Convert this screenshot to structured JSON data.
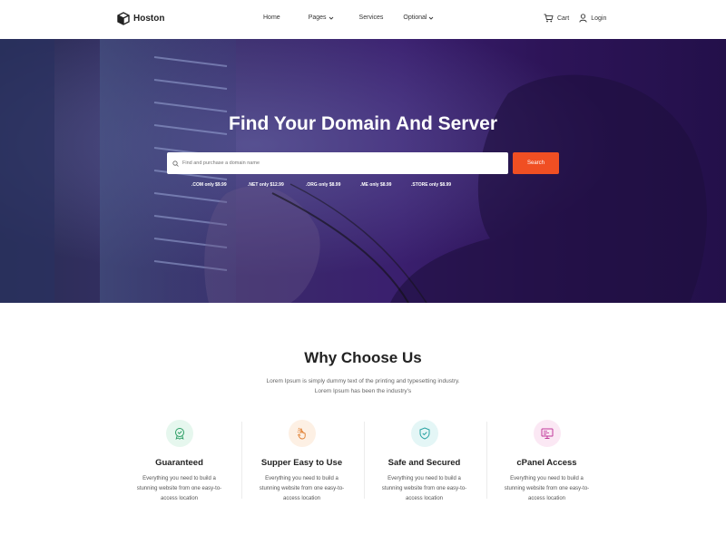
{
  "nav": {
    "brand": "Hoston",
    "links": [
      {
        "label": "Home",
        "dropdown": false
      },
      {
        "label": "Pages",
        "dropdown": true
      },
      {
        "label": "Services",
        "dropdown": false
      },
      {
        "label": "Optional",
        "dropdown": true
      }
    ],
    "cart_label": "Cart",
    "login_label": "Login"
  },
  "hero": {
    "title": "Find Your Domain And Server",
    "search_placeholder": "Find and purchase a domain name",
    "search_button": "Search",
    "prices": [
      ".COM only $9.99",
      ".NET only $12.99",
      ".ORG only $8.99",
      ".ME only $8.99",
      ".STORE only $8.99"
    ]
  },
  "why": {
    "title": "Why Choose Us",
    "description_line1": "Lorem Ipsum is simply dummy text of the printing and typesetting industry.",
    "description_line2": "Lorem Ipsum has been the industry's",
    "features": [
      {
        "title": "Guaranteed",
        "description": "Everything you need to build a stunning website from one easy-to-access location",
        "icon": "badge-icon",
        "bg": "#e6f7ee",
        "color": "#2a9d63"
      },
      {
        "title": "Supper Easy to Use",
        "description": "Everything you need to build a stunning website from one easy-to-access location",
        "icon": "hand-click-icon",
        "bg": "#fdf0e4",
        "color": "#e07b2a"
      },
      {
        "title": "Safe and Secured",
        "description": "Everything you need to build a stunning website from one easy-to-access location",
        "icon": "shield-icon",
        "bg": "#e4f6f6",
        "color": "#2aa3a3"
      },
      {
        "title": "cPanel Access",
        "description": "Everything you need to build a stunning website from one easy-to-access location",
        "icon": "monitor-icon",
        "bg": "#fbe8f4",
        "color": "#c0399a"
      }
    ]
  },
  "colors": {
    "accent": "#f04f23",
    "hero_purple": "#3a1f6e"
  }
}
